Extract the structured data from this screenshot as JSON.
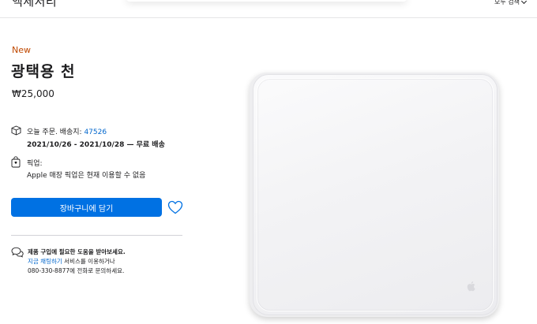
{
  "nav": {
    "category_title": "액세서리",
    "browse_all": "모두 검색"
  },
  "product": {
    "badge": "New",
    "name": "광택용 천",
    "price": "₩25,000"
  },
  "delivery": {
    "label": "오늘 주문. 배송지: ",
    "zip": "47526",
    "dates": "2021/10/26 - 2021/10/28 — 무료 배송"
  },
  "pickup": {
    "label": "픽업:",
    "status": "Apple 매장 픽업은 현재 이용할 수 없음"
  },
  "actions": {
    "add_to_bag": "장바구니에 담기"
  },
  "help": {
    "title": "제품 구입에 필요한 도움을 받아보세요.",
    "chat_link": "지금 채팅하기",
    "chat_suffix": " 서비스를 이용하거나",
    "phone": "080-330-8877에 전화로 문의하세요."
  },
  "icons": {
    "delivery": "box-icon",
    "pickup": "store-bag-icon",
    "favorite": "heart-icon",
    "help": "chat-bubbles-icon",
    "dropdown": "chevron-down-icon"
  },
  "colors": {
    "accent": "#0071e3",
    "link": "#0066cc",
    "badge": "#bf4800"
  }
}
